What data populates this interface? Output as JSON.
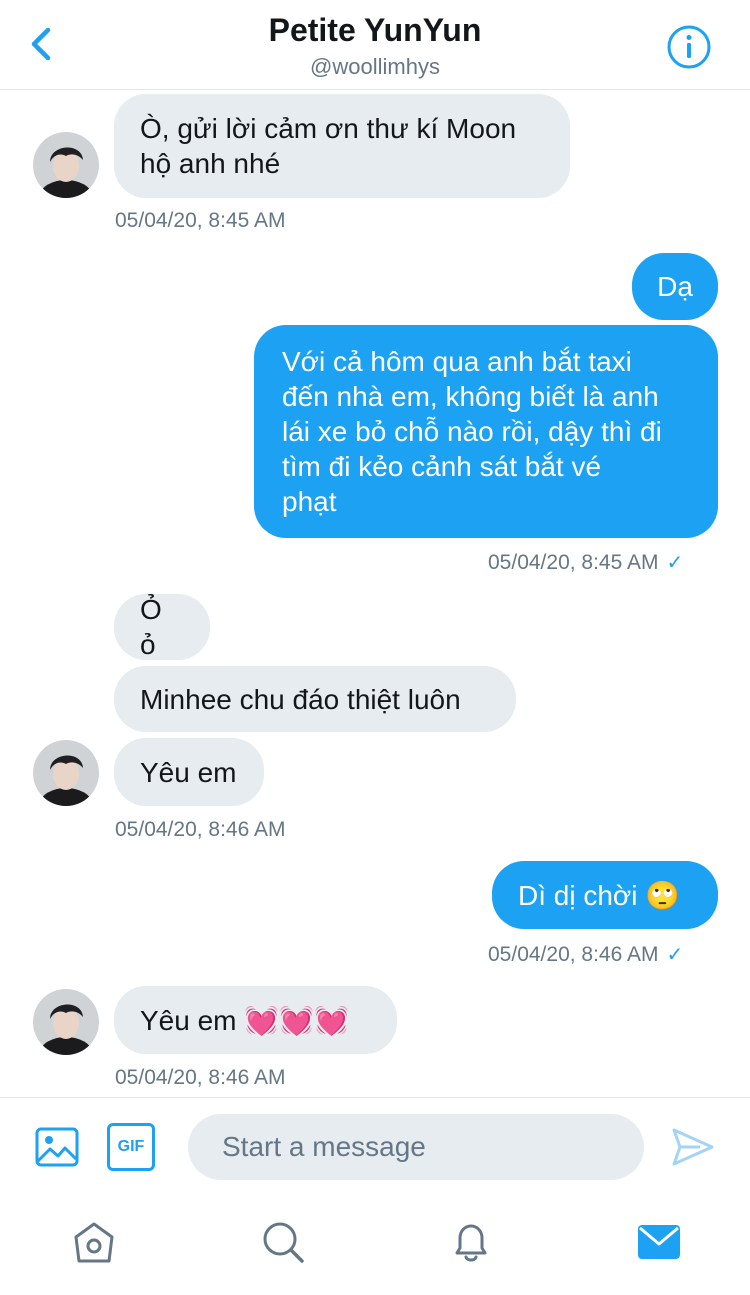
{
  "header": {
    "title": "Petite YunYun",
    "handle": "@woollimhys"
  },
  "messages": [
    {
      "side": "received",
      "text": "Ò, gửi lời cảm ơn thư kí Moon\nhộ anh nhé"
    },
    {
      "side": "received",
      "time": "05/04/20, 8:45 AM"
    },
    {
      "side": "sent",
      "text": "Dạ"
    },
    {
      "side": "sent",
      "text": "Với cả hôm qua anh bắt taxi\nđến nhà em, không biết là anh\nlái xe bỏ chỗ nào rồi, dậy thì đi\ntìm đi kẻo cảnh sát bắt vé\nphạt"
    },
    {
      "side": "sent",
      "time": "05/04/20, 8:45 AM",
      "check": "✓"
    },
    {
      "side": "received",
      "text": "Ỏ ỏ"
    },
    {
      "side": "received",
      "text": "Minhee chu đáo thiệt luôn"
    },
    {
      "side": "received",
      "text": "Yêu em"
    },
    {
      "side": "received",
      "time": "05/04/20, 8:46 AM"
    },
    {
      "side": "sent",
      "text": "Dì dị chời 🙄"
    },
    {
      "side": "sent",
      "time": "05/04/20, 8:46 AM",
      "check": "✓"
    },
    {
      "side": "received",
      "text": "Yêu em 💓💓💓"
    },
    {
      "side": "received",
      "time": "05/04/20, 8:46 AM"
    }
  ],
  "composer": {
    "placeholder": "Start a message",
    "gif_label": "GIF"
  },
  "colors": {
    "accent": "#1da1f2",
    "received_bubble": "#e6ecf0",
    "secondary_text": "#657786"
  },
  "icons": {
    "back": "chevron-left-icon",
    "info": "info-icon",
    "media": "image-icon",
    "gif": "gif-icon",
    "send": "send-icon",
    "tabs": [
      "home-icon",
      "search-icon",
      "bell-icon",
      "mail-icon"
    ]
  }
}
